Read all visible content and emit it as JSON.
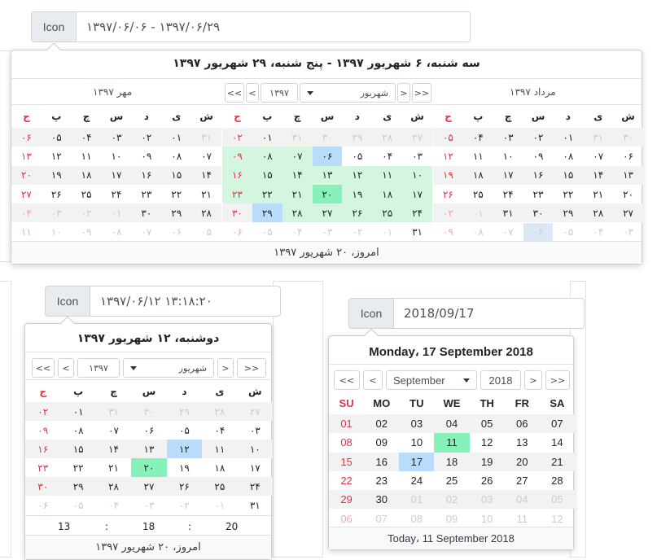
{
  "inputs": {
    "top": {
      "button": "Icon",
      "value": "۱۳۹۷/۰۶/۰۶ - ۱۳۹۷/۰۶/۲۹"
    },
    "mid": {
      "button": "Icon",
      "value": "۱۳۹۷/۰۶/۱۲   ۱۳:۱۸:۲۰"
    },
    "right": {
      "button": "Icon",
      "value": "2018/09/17"
    }
  },
  "colors": {
    "weekend_red": "#dc3545",
    "faded": "#c8ccd0",
    "faded_red": "#f1a7b0",
    "range_green": "#d4f5df",
    "selected_blue": "#b9dcfb",
    "today_green": "#86f2b9",
    "odd_row": "#f2f2f2"
  },
  "popup1": {
    "title": "سه شنبه، ۶ شهریور ۱۳۹۷ - پنج شنبه، ۲۹ شهریور ۱۳۹۷",
    "footer": "امروز، ۲۰ شهریور ۱۳۹۷",
    "nav": {
      "prev_year": "<<",
      "prev_month": "<",
      "month": "شهریور",
      "year": "۱۳۹۷",
      "next_month": ">",
      "next_year": ">>"
    },
    "left_label": "مهر ۱۳۹۷",
    "right_label": "مرداد ۱۳۹۷",
    "weekdays": [
      "ش",
      "ی",
      "د",
      "س",
      "چ",
      "پ",
      "ج"
    ],
    "left_month": [
      [
        "۳۱",
        "۰۱",
        "۰۲",
        "۰۳",
        "۰۴",
        "۰۵",
        "۰۶"
      ],
      [
        "۰۷",
        "۰۸",
        "۰۹",
        "۱۰",
        "۱۱",
        "۱۲",
        "۱۳"
      ],
      [
        "۱۴",
        "۱۵",
        "۱۶",
        "۱۷",
        "۱۸",
        "۱۹",
        "۲۰"
      ],
      [
        "۲۱",
        "۲۲",
        "۲۳",
        "۲۴",
        "۲۵",
        "۲۶",
        "۲۷"
      ],
      [
        "۲۸",
        "۲۹",
        "۳۰",
        "۰۱",
        "۰۲",
        "۰۳",
        "۰۴"
      ],
      [
        "۰۵",
        "۰۶",
        "۰۷",
        "۰۸",
        "۰۹",
        "۱۰",
        "۱۱"
      ]
    ],
    "center_month": [
      [
        "۲۷",
        "۲۸",
        "۲۹",
        "۳۰",
        "۳۱",
        "۰۱",
        "۰۲"
      ],
      [
        "۰۳",
        "۰۴",
        "۰۵",
        "۰۶",
        "۰۷",
        "۰۸",
        "۰۹"
      ],
      [
        "۱۰",
        "۱۱",
        "۱۲",
        "۱۳",
        "۱۴",
        "۱۵",
        "۱۶"
      ],
      [
        "۱۷",
        "۱۸",
        "۱۹",
        "۲۰",
        "۲۱",
        "۲۲",
        "۲۳"
      ],
      [
        "۲۴",
        "۲۵",
        "۲۶",
        "۲۷",
        "۲۸",
        "۲۹",
        "۳۰"
      ],
      [
        "۳۱",
        "۰۱",
        "۰۲",
        "۰۳",
        "۰۴",
        "۰۵",
        "۰۶"
      ]
    ],
    "right_month": [
      [
        "۳۰",
        "۳۱",
        "۰۱",
        "۰۲",
        "۰۳",
        "۰۴",
        "۰۵"
      ],
      [
        "۰۶",
        "۰۷",
        "۰۸",
        "۰۹",
        "۱۰",
        "۱۱",
        "۱۲"
      ],
      [
        "۱۳",
        "۱۴",
        "۱۵",
        "۱۶",
        "۱۷",
        "۱۸",
        "۱۹"
      ],
      [
        "۲۰",
        "۲۱",
        "۲۲",
        "۲۳",
        "۲۴",
        "۲۵",
        "۲۶"
      ],
      [
        "۲۷",
        "۲۸",
        "۲۹",
        "۳۰",
        "۳۱",
        "۰۱",
        "۰۲"
      ],
      [
        "۰۳",
        "۰۴",
        "۰۵",
        "۰۶",
        "۰۷",
        "۰۸",
        "۰۹"
      ]
    ]
  },
  "popup2": {
    "title": "دوشنبه، ۱۲ شهریور ۱۳۹۷",
    "footer": "امروز، ۲۰ شهریور ۱۳۹۷",
    "nav": {
      "prev_year": "<<",
      "prev_month": "<",
      "year": "۱۳۹۷",
      "month": "شهریور",
      "next_month": ">",
      "next_year": ">>"
    },
    "weekdays": [
      "ش",
      "ی",
      "د",
      "س",
      "چ",
      "پ",
      "ج"
    ],
    "days": [
      [
        "۲۷",
        "۲۸",
        "۲۹",
        "۳۰",
        "۳۱",
        "۰۱",
        "۰۲"
      ],
      [
        "۰۳",
        "۰۴",
        "۰۵",
        "۰۶",
        "۰۷",
        "۰۸",
        "۰۹"
      ],
      [
        "۱۰",
        "۱۱",
        "۱۲",
        "۱۳",
        "۱۴",
        "۱۵",
        "۱۶"
      ],
      [
        "۱۷",
        "۱۸",
        "۱۹",
        "۲۰",
        "۲۱",
        "۲۲",
        "۲۳"
      ],
      [
        "۲۴",
        "۲۵",
        "۲۶",
        "۲۷",
        "۲۸",
        "۲۹",
        "۳۰"
      ],
      [
        "۳۱",
        "۰۱",
        "۰۲",
        "۰۳",
        "۰۴",
        "۰۵",
        "۰۶"
      ]
    ],
    "time": {
      "hour": "13",
      "sep1": ":",
      "minute": "18",
      "sep2": ":",
      "second": "20"
    }
  },
  "popup3": {
    "title": "Monday، 17 September 2018",
    "footer": "Today، 11 September 2018",
    "nav": {
      "prev_year": "<<",
      "prev_month": "<",
      "month": "September",
      "year": "2018",
      "next_month": ">",
      "next_year": ">>"
    },
    "weekdays": [
      "SU",
      "MO",
      "TU",
      "WE",
      "TH",
      "FR",
      "SA"
    ],
    "days": [
      [
        "01",
        "02",
        "03",
        "04",
        "05",
        "06",
        "07"
      ],
      [
        "08",
        "09",
        "10",
        "11",
        "12",
        "13",
        "14"
      ],
      [
        "15",
        "16",
        "17",
        "18",
        "19",
        "20",
        "21"
      ],
      [
        "22",
        "23",
        "24",
        "25",
        "26",
        "27",
        "28"
      ],
      [
        "29",
        "30",
        "01",
        "02",
        "03",
        "04",
        "05"
      ],
      [
        "06",
        "07",
        "08",
        "09",
        "10",
        "11",
        "12"
      ]
    ]
  }
}
